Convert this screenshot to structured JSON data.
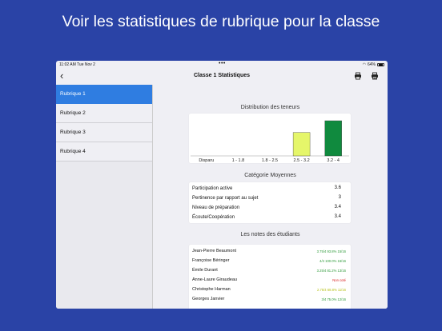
{
  "headline": "Voir les statistiques de rubrique pour la classe",
  "status": {
    "time": "11:02 AM  Tue Nov 2",
    "dots": "•••",
    "battery": "64%"
  },
  "nav": {
    "back_label": "‹",
    "title": "Classe 1 Statistiques"
  },
  "sidebar": {
    "items": [
      {
        "label": "Rubrique 1",
        "active": true
      },
      {
        "label": "Rubrique 2",
        "active": false
      },
      {
        "label": "Rubrique 3",
        "active": false
      },
      {
        "label": "Rubrique 4",
        "active": false
      }
    ]
  },
  "distribution": {
    "title": "Distribution des teneurs"
  },
  "chart_data": {
    "type": "bar",
    "title": "Distribution des teneurs",
    "categories": [
      "Disparu",
      "1 - 1.8",
      "1.8 - 2.5",
      "2.5 - 3.2",
      "3.2 - 4"
    ],
    "values": [
      0,
      0,
      0,
      2,
      3
    ],
    "ylim": [
      0,
      3
    ],
    "colors": [
      "#e5f66a",
      "#e5f66a",
      "#e5f66a",
      "#e5f66a",
      "#108a3e"
    ],
    "grid": false,
    "xlabel": "",
    "ylabel": ""
  },
  "categories": {
    "title": "Catégorie Moyennes",
    "rows": [
      {
        "label": "Participation active",
        "value": "3.6"
      },
      {
        "label": "Pertinence par rapport au sujet",
        "value": "3"
      },
      {
        "label": "Niveau de préparation",
        "value": "3.4"
      },
      {
        "label": "Écoute/Coopération",
        "value": "3.4"
      }
    ]
  },
  "students": {
    "title": "Les notes des étudiants",
    "rows": [
      {
        "name": "Jean-Pierre Beaumont",
        "grade": "3.75/4  93.8%  15/16",
        "color": "#2e9a3a"
      },
      {
        "name": "Françoise Béringer",
        "grade": "4/4  100.0%  16/16",
        "color": "#2e9a3a"
      },
      {
        "name": "Émile Durant",
        "grade": "3.25/4  81.2%  13/16",
        "color": "#2e9a3a"
      },
      {
        "name": "Anne-Laure Giraudeau",
        "grade": "Non coté",
        "color": "#d92020"
      },
      {
        "name": "Christophe Harman",
        "grade": "2.75/4  68.8%  11/16",
        "color": "#b8c21a"
      },
      {
        "name": "Georges Janvier",
        "grade": "3/4  75.0%  12/16",
        "color": "#2e9a3a"
      }
    ]
  }
}
